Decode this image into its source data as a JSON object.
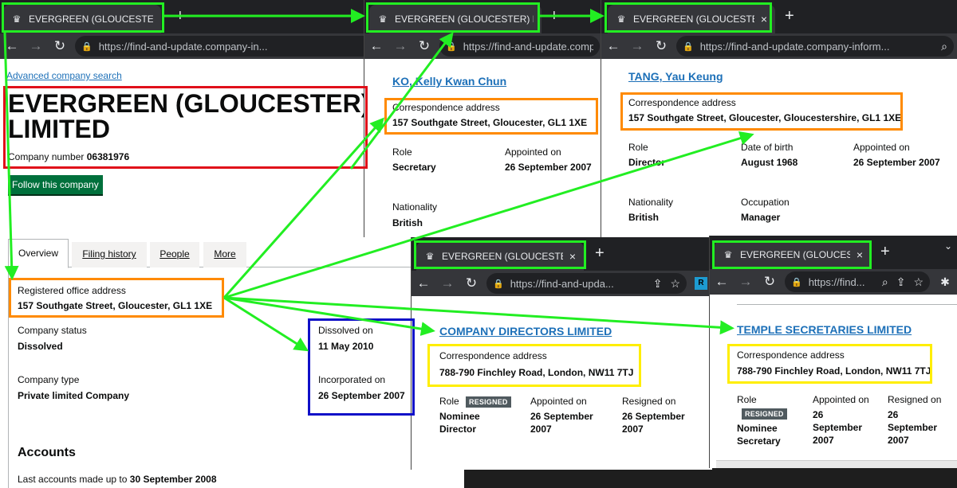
{
  "browser": {
    "tab_title": "EVERGREEN (GLOUCESTER) LIMIT",
    "new_tab": "+",
    "close": "×"
  },
  "main_window": {
    "url": "https://find-and-update.company-in...",
    "advanced_search": "Advanced company search",
    "company_name_line1": "EVERGREEN (GLOUCESTER)",
    "company_name_line2": "LIMITED",
    "company_number_label": "Company number",
    "company_number": "06381976",
    "follow_button": "Follow this company",
    "tabs": [
      "Overview",
      "Filing history",
      "People",
      "More"
    ],
    "registered_office_label": "Registered office address",
    "registered_office": "157 Southgate Street, Gloucester, GL1 1XE",
    "company_status_label": "Company status",
    "company_status": "Dissolved",
    "dissolved_on_label": "Dissolved on",
    "dissolved_on": "11 May 2010",
    "company_type_label": "Company type",
    "company_type": "Private limited Company",
    "incorporated_on_label": "Incorporated on",
    "incorporated_on": "26 September 2007",
    "accounts_heading": "Accounts",
    "last_accounts_label": "Last accounts made up to",
    "last_accounts": "30 September 2008"
  },
  "window_ko": {
    "url": "https://find-and-update.compa",
    "name": "KO, Kelly Kwan Chun",
    "correspondence_label": "Correspondence address",
    "correspondence": "157 Southgate Street, Gloucester, GL1 1XE",
    "role_label": "Role",
    "role": "Secretary",
    "appointed_label": "Appointed on",
    "appointed": "26 September 2007",
    "nationality_label": "Nationality",
    "nationality": "British"
  },
  "window_tang": {
    "url": "https://find-and-update.company-inform...",
    "name": "TANG, Yau Keung",
    "correspondence_label": "Correspondence address",
    "correspondence": "157 Southgate Street, Gloucester, Gloucestershire, GL1 1XE",
    "role_label": "Role",
    "role": "Director",
    "dob_label": "Date of birth",
    "dob": "August 1968",
    "appointed_label": "Appointed on",
    "appointed": "26 September 2007",
    "nationality_label": "Nationality",
    "nationality": "British",
    "occupation_label": "Occupation",
    "occupation": "Manager"
  },
  "window_directors": {
    "url": "https://find-and-upda...",
    "name": "COMPANY DIRECTORS LIMITED",
    "correspondence_label": "Correspondence address",
    "correspondence": "788-790 Finchley Road, London, NW11 7TJ",
    "role_label": "Role",
    "badge": "RESIGNED",
    "role_line1": "Nominee",
    "role_line2": "Director",
    "appointed_label": "Appointed on",
    "appointed_line1": "26 September",
    "appointed_line2": "2007",
    "resigned_label": "Resigned on",
    "resigned_line1": "26 September",
    "resigned_line2": "2007"
  },
  "window_secretaries": {
    "url": "https://find...",
    "name": "TEMPLE SECRETARIES LIMITED",
    "correspondence_label": "Correspondence address",
    "correspondence": "788-790 Finchley Road, London, NW11 7TJ",
    "role_label": "Role",
    "badge": "RESIGNED",
    "role_line1": "Nominee",
    "role_line2": "Secretary",
    "appointed_label": "Appointed on",
    "appointed_line1": "26",
    "appointed_line2": "September",
    "appointed_line3": "2007",
    "resigned_label": "Resigned on",
    "resigned_line1": "26",
    "resigned_line2": "September",
    "resigned_line3": "2007"
  },
  "colors": {
    "annotation_green": "#22ee22",
    "annotation_orange": "#ff8a00",
    "annotation_red": "#e0101a",
    "annotation_blue": "#1010c8",
    "annotation_yellow": "#ffee00",
    "link_blue": "#1d70b8",
    "follow_button": "#00703c"
  },
  "icons": [
    "crown-favicon-icon",
    "back-arrow-icon",
    "forward-arrow-icon",
    "reload-icon",
    "lock-icon",
    "search-icon",
    "zoom-icon",
    "share-icon",
    "star-icon",
    "extension-icon",
    "puzzle-icon"
  ]
}
